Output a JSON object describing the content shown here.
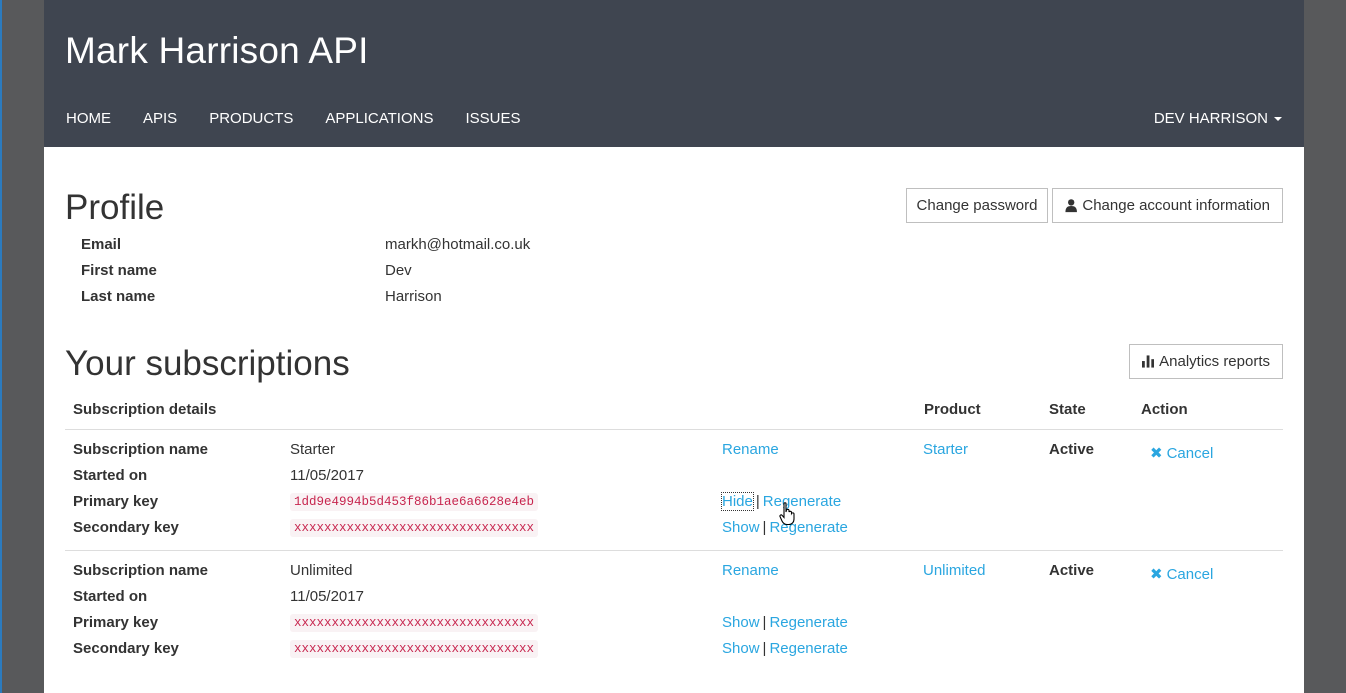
{
  "header": {
    "site_title": "Mark Harrison API",
    "nav": [
      "HOME",
      "APIS",
      "PRODUCTS",
      "APPLICATIONS",
      "ISSUES"
    ],
    "user_menu": "DEV HARRISON"
  },
  "profile": {
    "title": "Profile",
    "change_password": "Change password",
    "change_account": "Change account information",
    "fields": [
      {
        "label": "Email",
        "value": "markh@hotmail.co.uk"
      },
      {
        "label": "First name",
        "value": "Dev"
      },
      {
        "label": "Last name",
        "value": "Harrison"
      }
    ]
  },
  "subscriptions": {
    "title": "Your subscriptions",
    "analytics_button": "Analytics reports",
    "columns": [
      "Subscription details",
      "Product",
      "State",
      "Action"
    ],
    "row_labels": [
      "Subscription name",
      "Started on",
      "Primary key",
      "Secondary key"
    ],
    "link_rename": "Rename",
    "link_show": "Show",
    "link_hide": "Hide",
    "link_regenerate": "Regenerate",
    "link_cancel": "Cancel",
    "separator": "|",
    "items": [
      {
        "name": "Starter",
        "started_on": "11/05/2017",
        "primary_key": "1dd9e4994b5d453f86b1ae6a6628e4eb",
        "primary_toggle": "Hide",
        "secondary_key": "xxxxxxxxxxxxxxxxxxxxxxxxxxxxxxxx",
        "secondary_toggle": "Show",
        "product": "Starter",
        "state": "Active"
      },
      {
        "name": "Unlimited",
        "started_on": "11/05/2017",
        "primary_key": "xxxxxxxxxxxxxxxxxxxxxxxxxxxxxxxx",
        "primary_toggle": "Show",
        "secondary_key": "xxxxxxxxxxxxxxxxxxxxxxxxxxxxxxxx",
        "secondary_toggle": "Show",
        "product": "Unlimited",
        "state": "Active"
      }
    ]
  },
  "colors": {
    "header_bg": "#3f4550",
    "link": "#2aa6e0",
    "key_text": "#c7254e",
    "key_bg": "#f9f2f4",
    "page_bg": "#58595b"
  }
}
